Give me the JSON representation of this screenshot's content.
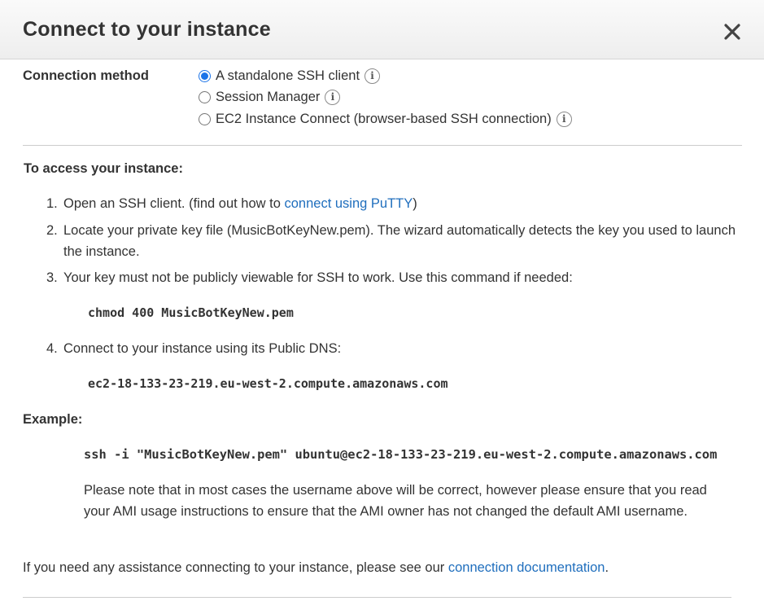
{
  "dialog": {
    "title": "Connect to your instance",
    "close_label": "close"
  },
  "connection_method": {
    "label": "Connection method",
    "options": [
      {
        "label": "A standalone SSH client",
        "selected": true
      },
      {
        "label": "Session Manager",
        "selected": false
      },
      {
        "label": "EC2 Instance Connect (browser-based SSH connection)",
        "selected": false
      }
    ],
    "info_glyph": "i"
  },
  "access": {
    "heading": "To access your instance:",
    "steps": [
      {
        "num": "1.",
        "text_before": "Open an SSH client. (find out how to",
        "link": "connect using PuTTY",
        "text_after": ")"
      },
      {
        "num": "2.",
        "text": "Locate your private key file (MusicBotKeyNew.pem). The wizard automatically detects the key you used to launch the instance."
      },
      {
        "num": "3.",
        "text": "Your key must not be publicly viewable for SSH to work. Use this command if needed:",
        "code": "chmod 400 MusicBotKeyNew.pem"
      },
      {
        "num": "4.",
        "text": "Connect to your instance using its Public DNS:",
        "code": "ec2-18-133-23-219.eu-west-2.compute.amazonaws.com"
      }
    ]
  },
  "example": {
    "heading": "Example:",
    "command": "ssh -i \"MusicBotKeyNew.pem\" ubuntu@ec2-18-133-23-219.eu-west-2.compute.amazonaws.com",
    "note": "Please note that in most cases the username above will be correct, however please ensure that you read your AMI usage instructions to ensure that the AMI owner has not changed the default AMI username."
  },
  "footer": {
    "text": "If you need any assistance connecting to your instance, please see our",
    "link": "connection documentation",
    "period": "."
  },
  "colors": {
    "link": "#1f6ebd",
    "radio_selected": "#1a73e8",
    "text": "#333333"
  }
}
